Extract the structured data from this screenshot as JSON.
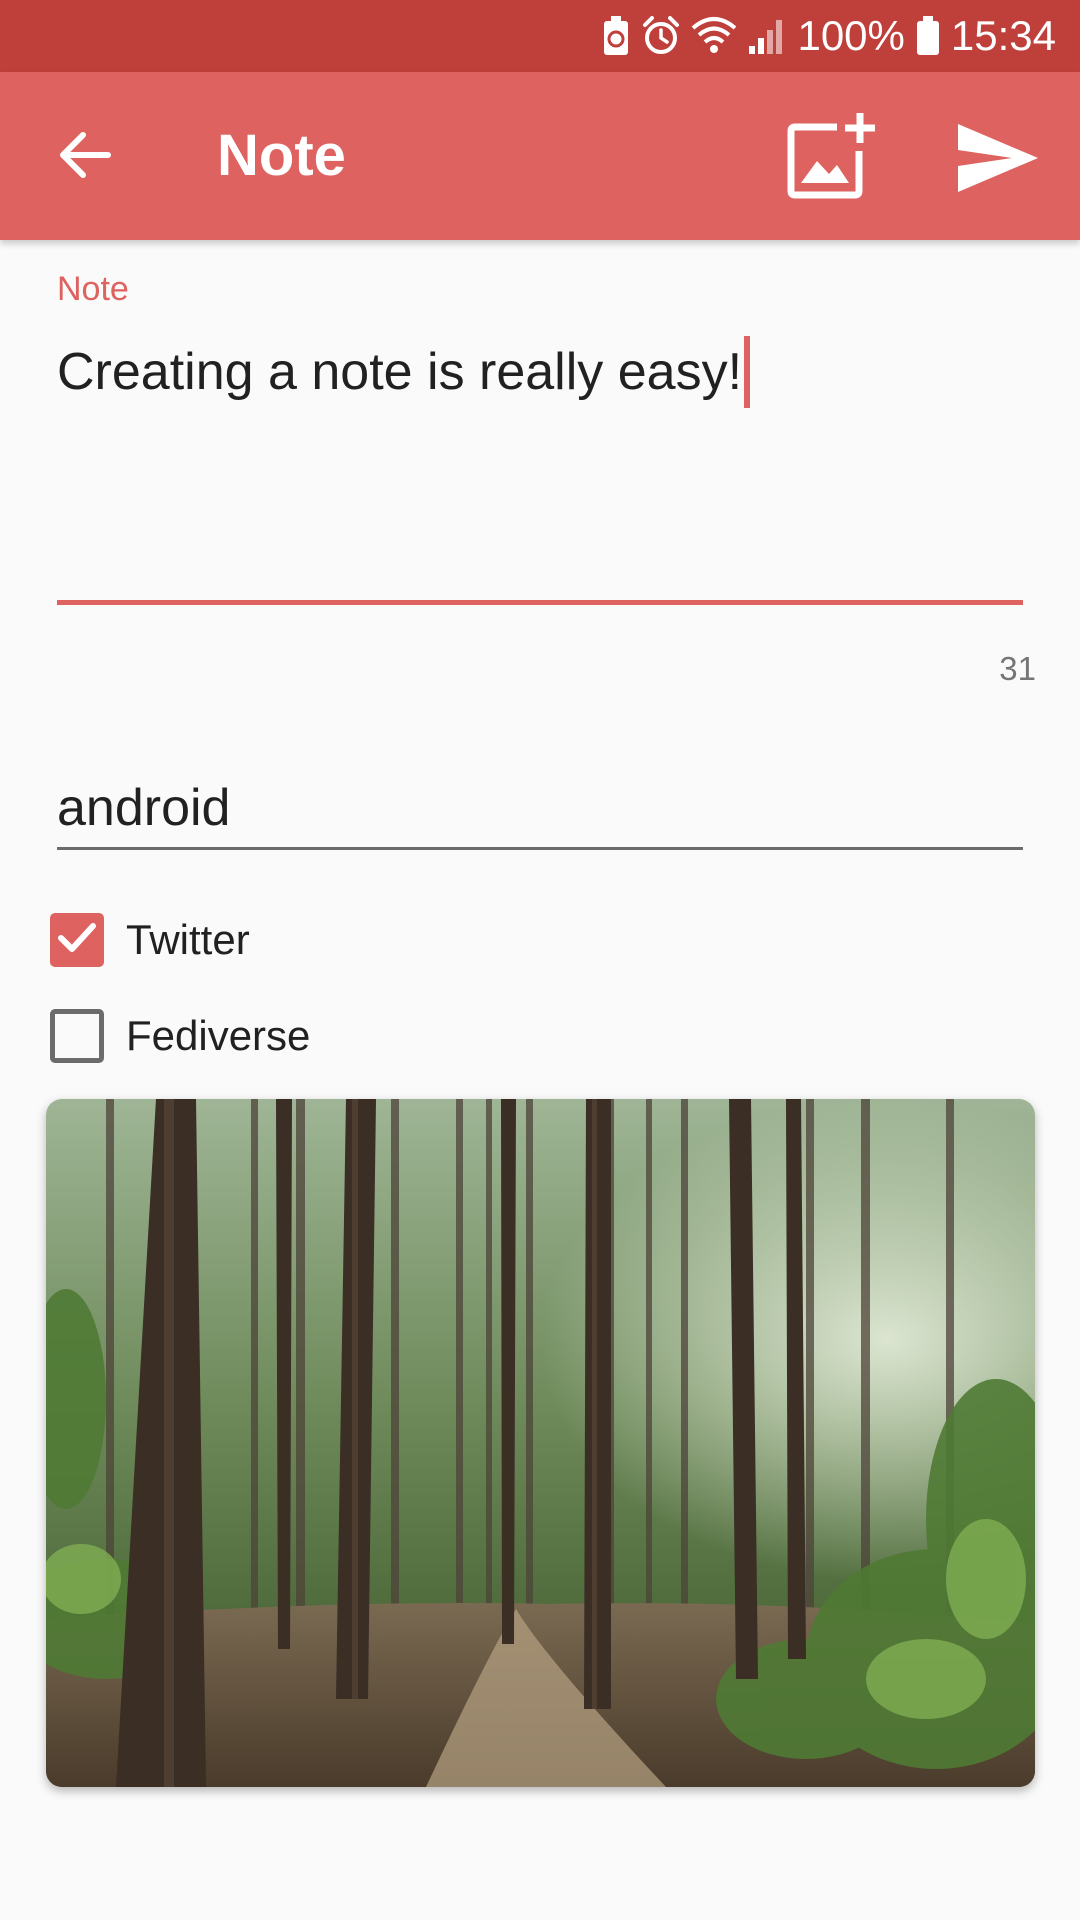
{
  "status_bar": {
    "battery_percent": "100%",
    "time": "15:34",
    "icons": [
      "battery-saver-icon",
      "alarm-icon",
      "wifi-icon",
      "signal-icon",
      "battery-icon"
    ]
  },
  "app_bar": {
    "title": "Note",
    "icons": [
      "back-arrow-icon",
      "add-image-icon",
      "send-icon"
    ]
  },
  "note_field": {
    "label": "Note",
    "value": "Creating a note is really easy!",
    "char_count": "31"
  },
  "tag_field": {
    "value": "android"
  },
  "targets": [
    {
      "label": "Twitter",
      "checked": true
    },
    {
      "label": "Fediverse",
      "checked": false
    }
  ],
  "attachment": {
    "type": "photo",
    "subject": "forest-path"
  },
  "colors": {
    "status_bar": "#bf3f3b",
    "app_bar": "#de625f",
    "accent": "#de625f",
    "background": "#fafafa"
  }
}
